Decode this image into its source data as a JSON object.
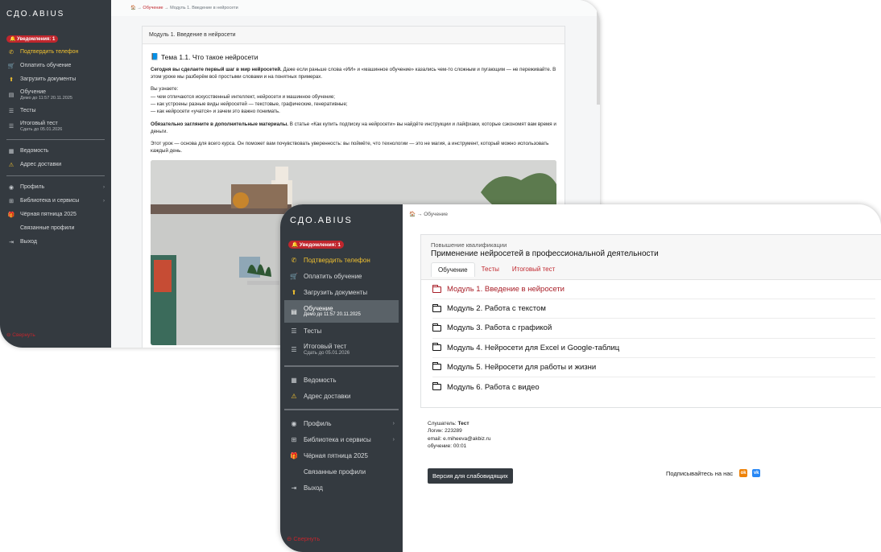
{
  "back_window": {
    "sidebar": {
      "brand": "СДО.ABIUS",
      "notification": "Уведомления: 1",
      "items": [
        {
          "label": "Подтвердить телефон",
          "icon": "phone-icon",
          "accent": true
        },
        {
          "label": "Оплатить обучение",
          "icon": "cart-icon"
        },
        {
          "label": "Загрузить документы",
          "icon": "upload-icon"
        },
        {
          "label": "Обучение",
          "sub": "Демо до 11:57 20.11.2025",
          "icon": "book-icon"
        },
        {
          "label": "Тесты",
          "icon": "list-icon"
        },
        {
          "label": "Итоговый тест",
          "sub": "Сдать до 05.01.2026",
          "icon": "list-icon"
        },
        {
          "label": "Ведомость",
          "icon": "table-icon"
        },
        {
          "label": "Адрес доставки",
          "icon": "warning-icon"
        },
        {
          "label": "Профиль",
          "icon": "user-icon"
        },
        {
          "label": "Библиотека и сервисы",
          "icon": "grid-icon"
        },
        {
          "label": "Чёрная пятница 2025",
          "icon": "gift-icon"
        },
        {
          "label": "Связанные профили"
        },
        {
          "label": "Выход",
          "icon": "logout-icon"
        }
      ],
      "collapse": "Свернуть"
    },
    "breadcrumb": {
      "home": "🏠",
      "sep": "→",
      "level1": "Обучение",
      "level2": "Модуль 1. Введение в нейросети"
    },
    "card": {
      "header": "Модуль 1. Введение в нейросети",
      "topic": "Тема 1.1. Что такое нейросети",
      "p1_bold": "Сегодня вы сделаете первый шаг в мир нейросетей.",
      "p1_rest": " Даже если раньше слова «ИИ» и «машинное обучение» казались чем-то сложным и пугающим — не переживайте. В этом уроке мы разберём всё простыми словами и на понятных примерах.",
      "p2_intro": "Вы узнаете:",
      "p2_lines": [
        "— чем отличаются искусственный интеллект, нейросети и машинное обучение;",
        "— как устроены разные виды нейросетей — текстовые, графические, генеративные;",
        "— как нейросети «учатся» и зачем это важно понимать."
      ],
      "p3_bold": "Обязательно загляните в дополнительные материалы.",
      "p3_rest": " В статье «Как купить подписку на нейросети» вы найдёте инструкции и лайфхаки, которые сэкономят вам время и деньги.",
      "p4": "Этот урок — основа для всего курса. Он поможет вам почувствовать уверенность: вы поймёте, что технологии — это не магия, а инструмент, который можно использовать каждый день."
    }
  },
  "front_window": {
    "sidebar": {
      "brand": "СДО.ABIUS",
      "notification": "Уведомления: 1",
      "items": [
        {
          "label": "Подтвердить телефон",
          "icon": "phone-icon",
          "accent": true
        },
        {
          "label": "Оплатить обучение",
          "icon": "cart-icon"
        },
        {
          "label": "Загрузить документы",
          "icon": "upload-icon"
        },
        {
          "label": "Обучение",
          "sub": "Демо до 11:57 20.11.2025",
          "icon": "book-icon",
          "active": true
        },
        {
          "label": "Тесты",
          "icon": "list-icon"
        },
        {
          "label": "Итоговый тест",
          "sub": "Сдать до 05.01.2026",
          "icon": "list-icon"
        },
        {
          "label": "Ведомость",
          "icon": "table-icon"
        },
        {
          "label": "Адрес доставки",
          "icon": "warning-icon"
        },
        {
          "label": "Профиль",
          "icon": "user-icon"
        },
        {
          "label": "Библиотека и сервисы",
          "icon": "grid-icon"
        },
        {
          "label": "Чёрная пятница 2025",
          "icon": "gift-icon"
        },
        {
          "label": "Связанные профили"
        },
        {
          "label": "Выход",
          "icon": "logout-icon"
        }
      ],
      "collapse": "Свернуть"
    },
    "breadcrumb": {
      "home": "🏠",
      "sep": "→",
      "level1": "Обучение"
    },
    "course": {
      "category": "Повышение квалификации",
      "title": "Применение нейросетей в профессиональной деятельности",
      "tabs": [
        "Обучение",
        "Тесты",
        "Итоговый тест"
      ],
      "modules": [
        "Модуль 1. Введение в нейросети",
        "Модуль 2. Работа с текстом",
        "Модуль 3. Работа с графикой",
        "Модуль 4. Нейросети для Excel и Google-таблиц",
        "Модуль 5. Нейросети для работы и жизни",
        "Модуль 6. Работа с видео"
      ]
    },
    "listener": {
      "name_label": "Слушатель:",
      "name": "Тест",
      "login_label": "Логин:",
      "login": "223289",
      "email_label": "email:",
      "email": "e.miheeva@akbiz.ru",
      "study_label": "обучение:",
      "study": "00:01"
    },
    "accessibility_button": "Версия для слабовидящих",
    "subscribe": "Подписывайтесь на нас",
    "colors": {
      "sidebar": "#343a40",
      "accent": "#c0262d",
      "warning": "#f2c230"
    }
  }
}
